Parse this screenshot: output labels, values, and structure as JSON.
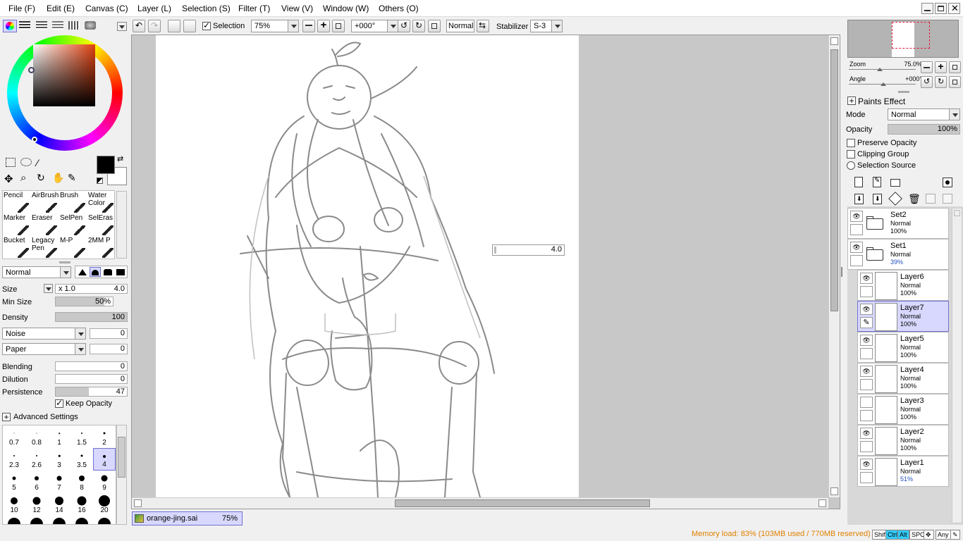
{
  "menu": [
    "File (F)",
    "Edit (E)",
    "Canvas (C)",
    "Layer (L)",
    "Selection (S)",
    "Filter (T)",
    "View (V)",
    "Window (W)",
    "Others (O)"
  ],
  "toolbar": {
    "selection_label": "Selection",
    "zoom": "75%",
    "angle": "+000°",
    "blend": "Normal",
    "stabilizer_label": "Stabilizer",
    "stabilizer": "S-3"
  },
  "tools": {
    "rows": [
      [
        "Pencil",
        "AirBrush",
        "Brush",
        "Water Color"
      ],
      [
        "Marker",
        "Eraser",
        "SelPen",
        "SelEras"
      ],
      [
        "Bucket",
        "Legacy Pen",
        "M-P",
        "2MM P"
      ]
    ]
  },
  "brush": {
    "mode": "Normal",
    "size_label": "Size",
    "size_mult": "x 1.0",
    "size": "4.0",
    "minsize_label": "Min Size",
    "minsize": "50%",
    "minsize_frac": 0.85,
    "density_label": "Density",
    "density": "100",
    "density_frac": 1.0,
    "noise": "Noise",
    "noise_val": "0",
    "paper": "Paper",
    "paper_val": "0",
    "blending_label": "Blending",
    "blending": "0",
    "dilution_label": "Dilution",
    "dilution": "0",
    "persistence_label": "Persistence",
    "persistence": "47",
    "persistence_frac": 0.47,
    "keep_opacity": "Keep Opacity",
    "advanced": "Advanced Settings"
  },
  "brush_sizes": [
    [
      "0.7",
      "0.8",
      "1",
      "1.5",
      "2"
    ],
    [
      "2.3",
      "2.6",
      "3",
      "3.5",
      "4"
    ],
    [
      "5",
      "6",
      "7",
      "8",
      "9"
    ],
    [
      "10",
      "12",
      "14",
      "16",
      "20"
    ]
  ],
  "canvas": {
    "size_popup": "4.0",
    "tab_name": "orange-jing.sai",
    "tab_zoom": "75%"
  },
  "navigator": {
    "zoom_label": "Zoom",
    "zoom": "75.0%",
    "angle_label": "Angle",
    "angle": "+000°"
  },
  "effects": {
    "paints_effect": "Paints Effect",
    "mode_label": "Mode",
    "mode": "Normal",
    "opacity_label": "Opacity",
    "opacity": "100%",
    "opacity_frac": 1.0,
    "preserve": "Preserve Opacity",
    "clipping": "Clipping Group",
    "selsource": "Selection Source"
  },
  "layers": [
    {
      "name": "Set2",
      "mode": "Normal",
      "opacity": "100%",
      "folder": true
    },
    {
      "name": "Set1",
      "mode": "Normal",
      "opacity": "39%",
      "folder": true
    },
    {
      "name": "Layer6",
      "mode": "Normal",
      "opacity": "100%"
    },
    {
      "name": "Layer7",
      "mode": "Normal",
      "opacity": "100%",
      "selected": true
    },
    {
      "name": "Layer5",
      "mode": "Normal",
      "opacity": "100%"
    },
    {
      "name": "Layer4",
      "mode": "Normal",
      "opacity": "100%"
    },
    {
      "name": "Layer3",
      "mode": "Normal",
      "opacity": "100%"
    },
    {
      "name": "Layer2",
      "mode": "Normal",
      "opacity": "100%"
    },
    {
      "name": "Layer1",
      "mode": "Normal",
      "opacity": "51%"
    }
  ],
  "status": {
    "memory": "Memory load: 83% (103MB used / 770MB reserved)",
    "keys": [
      "Shift",
      "Ctrl",
      "Alt",
      "SPC",
      "Any"
    ]
  }
}
